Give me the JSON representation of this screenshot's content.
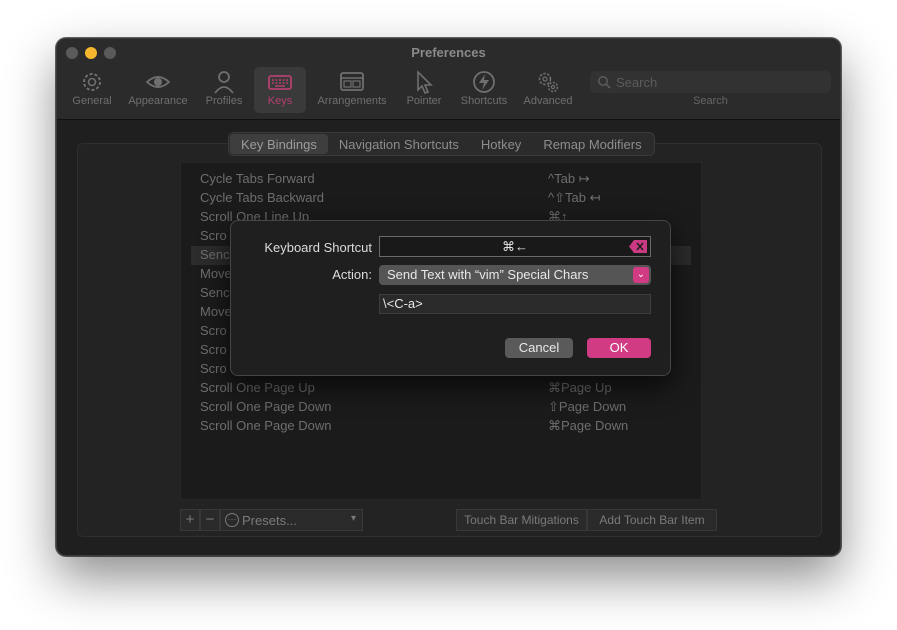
{
  "window": {
    "title": "Preferences"
  },
  "toolbar": {
    "tabs": [
      {
        "label": "General",
        "icon": "gear-icon"
      },
      {
        "label": "Appearance",
        "icon": "eye-icon"
      },
      {
        "label": "Profiles",
        "icon": "person-icon"
      },
      {
        "label": "Keys",
        "icon": "keyboard-icon",
        "active": true
      },
      {
        "label": "Arrangements",
        "icon": "window-icon"
      },
      {
        "label": "Pointer",
        "icon": "pointer-icon"
      },
      {
        "label": "Shortcuts",
        "icon": "bolt-icon"
      },
      {
        "label": "Advanced",
        "icon": "gears-icon"
      }
    ],
    "search_placeholder": "Search",
    "search_caption": "Search"
  },
  "segments": [
    "Key Bindings",
    "Navigation Shortcuts",
    "Hotkey",
    "Remap Modifiers"
  ],
  "bindings": [
    {
      "action": "Cycle Tabs Forward",
      "keys": "^Tab ↦"
    },
    {
      "action": "Cycle Tabs Backward",
      "keys": "^⇧Tab ↤"
    },
    {
      "action": "Scroll One Line Up",
      "keys": "⌘↑"
    },
    {
      "action": "Scro",
      "keys": ""
    },
    {
      "action": "Senc",
      "keys": ""
    },
    {
      "action": "Move",
      "keys": ""
    },
    {
      "action": "Senc",
      "keys": ""
    },
    {
      "action": "Move",
      "keys": ""
    },
    {
      "action": "Scro",
      "keys": ""
    },
    {
      "action": "Scro",
      "keys": ""
    },
    {
      "action": "Scro",
      "keys": ""
    },
    {
      "action": "Scroll One Page Up",
      "keys": "⌘Page Up"
    },
    {
      "action": "Scroll One Page Down",
      "keys": "⇧Page Down"
    },
    {
      "action": "Scroll One Page Down",
      "keys": "⌘Page Down"
    }
  ],
  "bottom": {
    "add": "+",
    "remove": "−",
    "presets": "Presets...",
    "touch_bar_mitigations": "Touch Bar Mitigations",
    "add_touch_bar_item": "Add Touch Bar Item"
  },
  "dialog": {
    "shortcut_label": "Keyboard Shortcut",
    "shortcut_value": "⌘←",
    "action_label": "Action:",
    "action_value": "Send Text with “vim” Special Chars",
    "param_value": "\\<C-a>",
    "cancel": "Cancel",
    "ok": "OK"
  },
  "colors": {
    "accent": "#d13b84",
    "window_bg": "#1f1f1f"
  }
}
